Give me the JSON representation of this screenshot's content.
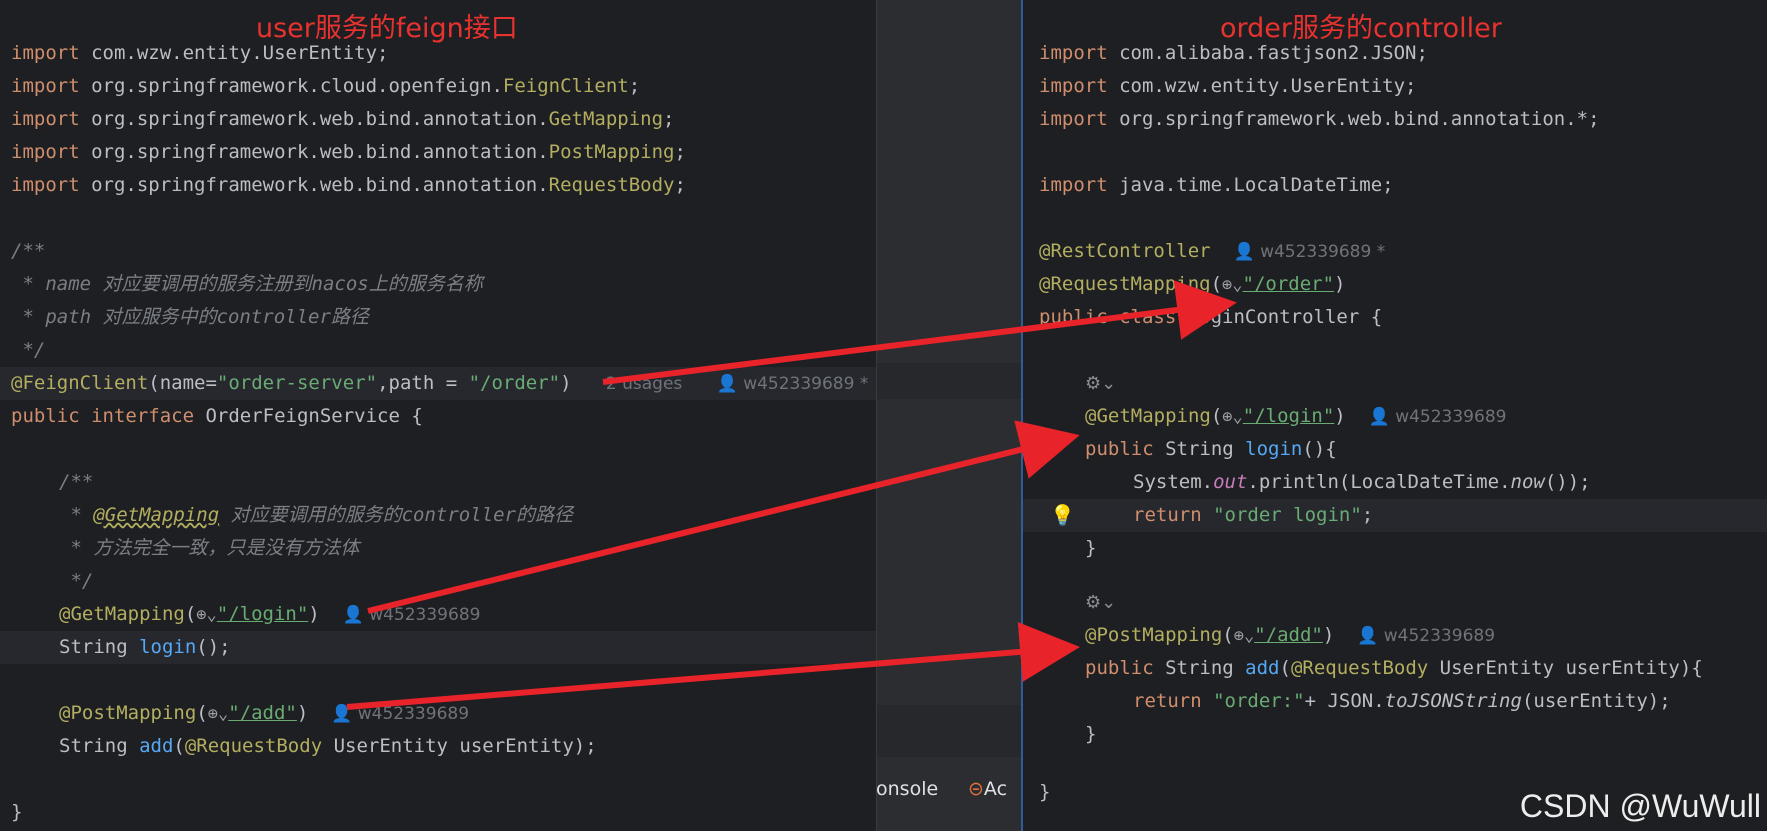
{
  "left": {
    "title": "user服务的feign接口",
    "lines": [
      [
        "import com.wzw.entity.UserEntity;"
      ],
      [
        "import org.springframework.cloud.openfeign.",
        "FeignClient",
        ";"
      ],
      [
        "import org.springframework.web.bind.annotation.",
        "GetMapping",
        ";"
      ],
      [
        "import org.springframework.web.bind.annotation.",
        "PostMapping",
        ";"
      ],
      [
        "import org.springframework.web.bind.annotation.",
        "RequestBody",
        ";"
      ],
      "/**",
      " * name 对应要调用的服务注册到nacos上的服务名称",
      " * path 对应服务中的controller路径",
      " */",
      [
        "@FeignClient",
        "(name=",
        "\"order-server\"",
        ",path = ",
        "\"/order\"",
        ")",
        "2 usages",
        "w452339689 *"
      ],
      [
        "public interface ",
        "OrderFeignService {"
      ],
      "/**",
      [
        "@GetMapping",
        " 对应要调用的服务的controller的路径"
      ],
      " * 方法完全一致，只是没有方法体",
      " */",
      [
        "@GetMapping",
        "\"/login\"",
        "w452339689"
      ],
      [
        "String ",
        "login",
        "();"
      ],
      [
        "@PostMapping",
        "\"/add\"",
        "w452339689"
      ],
      [
        "String ",
        "add",
        "@RequestBody",
        " UserEntity userEntity);"
      ],
      "}"
    ]
  },
  "middle": {
    "tab_console": "onsole",
    "tab_actuator": "Ac"
  },
  "right": {
    "title": "order服务的controller",
    "lines": [
      [
        "import com.alibaba.fastjson2.JSON;"
      ],
      [
        "import com.wzw.entity.UserEntity;"
      ],
      [
        "import org.springframework.web.bind.annotation.*;"
      ],
      [
        "import java.time.LocalDateTime;"
      ],
      [
        "@RestController",
        "w452339689 *"
      ],
      [
        "@RequestMapping",
        "\"/order\""
      ],
      [
        "public class ",
        "LoginController {"
      ],
      [
        "@GetMapping",
        "\"/login\"",
        "w452339689"
      ],
      [
        "public ",
        "String ",
        "login",
        "(){"
      ],
      [
        "System.",
        "out",
        ".println(LocalDateTime.",
        "now",
        "());"
      ],
      [
        "return ",
        "\"order login\"",
        ";"
      ],
      "}",
      [
        "@PostMapping",
        "\"/add\"",
        "w452339689"
      ],
      [
        "public ",
        "String ",
        "add",
        "@RequestBody",
        " UserEntity userEntity){"
      ],
      [
        "return ",
        "\"order:\"",
        "+ JSON.",
        "toJSONString",
        "(userEntity);"
      ],
      "}",
      "}"
    ]
  },
  "watermark": "CSDN @WuWull",
  "colors": {
    "background": "#1e1f22",
    "keyword": "#cf8e6d",
    "string": "#6aab73",
    "annotation": "#b3ae60",
    "method": "#56a8f5",
    "comment": "#7a7e85",
    "title_red": "#e8322f",
    "arrow_red": "#e8232a"
  }
}
